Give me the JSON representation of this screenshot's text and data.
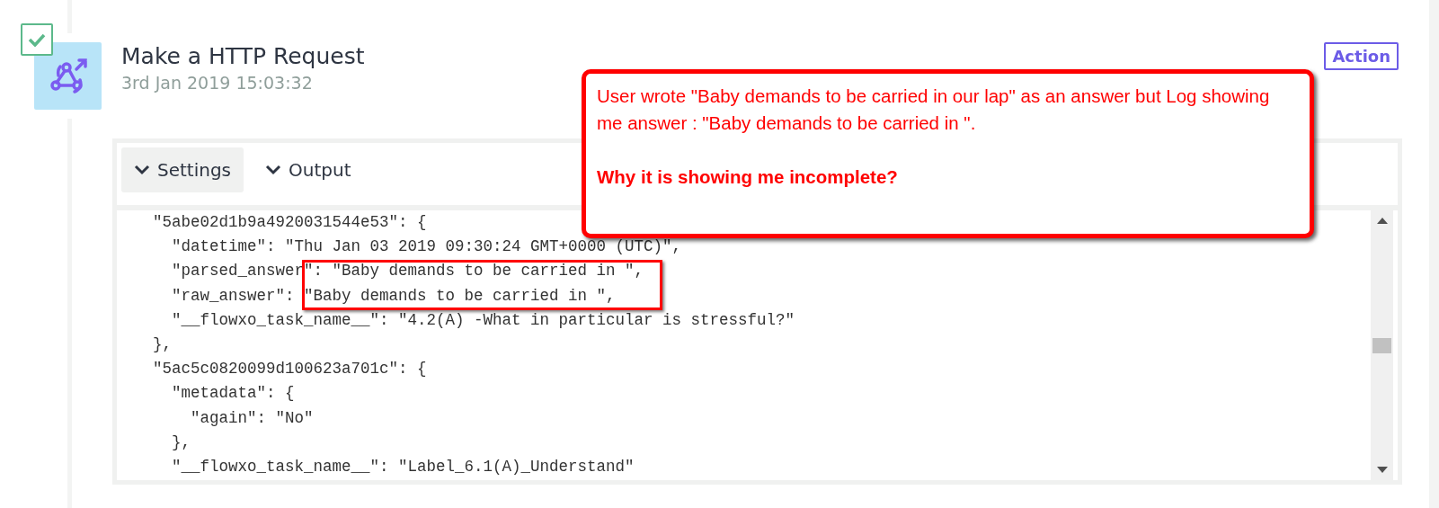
{
  "step": {
    "done": true,
    "title": "Make a HTTP Request",
    "timestamp": "3rd Jan 2019 15:03:32",
    "badge": "Action"
  },
  "tabs": [
    {
      "label": "Settings",
      "selected": true
    },
    {
      "label": "Output",
      "selected": false
    }
  ],
  "code_lines": [
    "\"5abe02d1b9a4920031544e53\": {",
    "  \"datetime\": \"Thu Jan 03 2019 09:30:24 GMT+0000 (UTC)\",",
    "  \"parsed_answer\": \"Baby demands to be carried in \",",
    "  \"raw_answer\": \"Baby demands to be carried in \",",
    "  \"__flowxo_task_name__\": \"4.2(A) -What in particular is stressful?\"",
    "},",
    "\"5ac5c0820099d100623a701c\": {",
    "  \"metadata\": {",
    "    \"again\": \"No\"",
    "  },",
    "  \"__flowxo_task_name__\": \"Label_6.1(A)_Understand\""
  ],
  "annotations": {
    "callout": {
      "text": "User wrote \"Baby demands to be carried in our lap\" as an answer but Log showing me answer : \"Baby demands to be carried in \".",
      "question": "Why it is showing me incomplete?"
    },
    "highlight": true
  }
}
